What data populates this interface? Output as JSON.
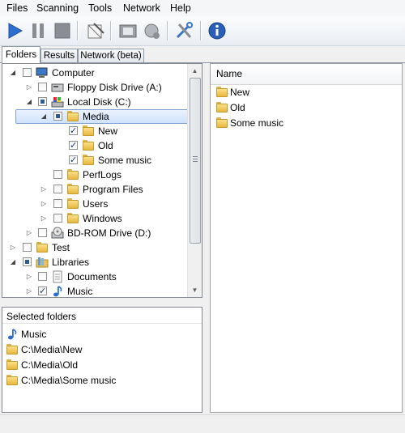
{
  "menu": [
    "Files",
    "Scanning",
    "Tools",
    "Network",
    "Help"
  ],
  "toolbar": {
    "buttons": [
      "play-icon",
      "pause-icon",
      "stop-icon",
      "edit-document-icon",
      "film-icon",
      "globe-settings-icon",
      "tools-icon",
      "info-icon"
    ]
  },
  "tabs": [
    "Folders",
    "Results",
    "Network (beta)"
  ],
  "tree": {
    "items": [
      {
        "label": "Computer",
        "icon": "computer-icon"
      },
      {
        "label": "Floppy Disk Drive (A:)",
        "icon": "floppy-icon"
      },
      {
        "label": "Local Disk (C:)",
        "icon": "hard-disk-icon"
      },
      {
        "label": "Media",
        "icon": "folder-icon"
      },
      {
        "label": "New",
        "icon": "folder-icon"
      },
      {
        "label": "Old",
        "icon": "folder-icon"
      },
      {
        "label": "Some music",
        "icon": "folder-icon"
      },
      {
        "label": "PerfLogs",
        "icon": "folder-icon"
      },
      {
        "label": "Program Files",
        "icon": "folder-icon"
      },
      {
        "label": "Users",
        "icon": "folder-icon"
      },
      {
        "label": "Windows",
        "icon": "folder-icon"
      },
      {
        "label": "BD-ROM Drive (D:)",
        "icon": "disc-drive-icon"
      },
      {
        "label": "Test",
        "icon": "user-folder-icon"
      },
      {
        "label": "Libraries",
        "icon": "libraries-icon"
      },
      {
        "label": "Documents",
        "icon": "documents-icon"
      },
      {
        "label": "Music",
        "icon": "music-note-icon"
      }
    ]
  },
  "selected": {
    "header": "Selected folders",
    "items": [
      {
        "label": "Music",
        "icon": "music-note-icon"
      },
      {
        "label": "C:\\Media\\New",
        "icon": "folder-icon"
      },
      {
        "label": "C:\\Media\\Old",
        "icon": "folder-icon"
      },
      {
        "label": "C:\\Media\\Some music",
        "icon": "folder-icon"
      }
    ]
  },
  "files": {
    "column": "Name",
    "items": [
      "New",
      "Old",
      "Some music"
    ]
  },
  "colors": {
    "accent": "#2a6fc9",
    "selection": "#cfe3fb"
  }
}
